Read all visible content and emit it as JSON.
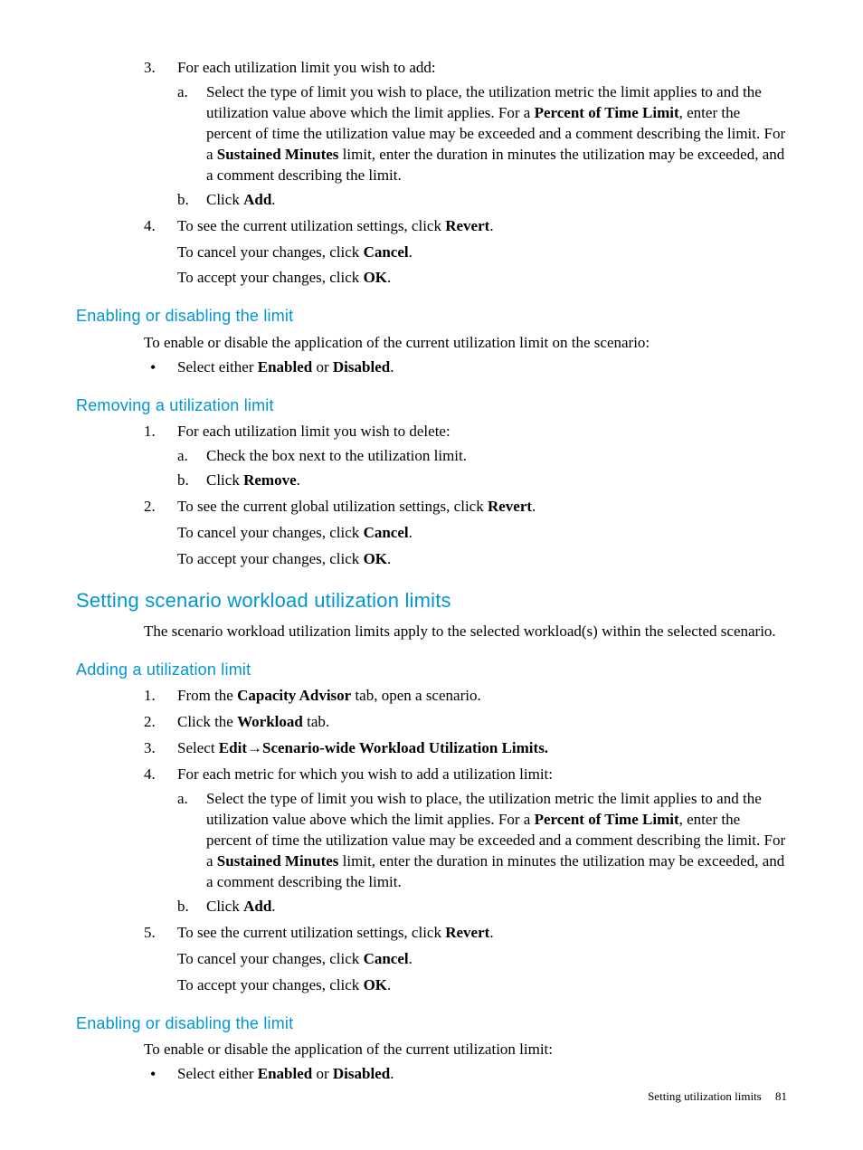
{
  "sec1": {
    "ol": [
      {
        "n": "3.",
        "t": "For each utilization limit you wish to add:",
        "sub": [
          {
            "n": "a.",
            "pre": "Select the type of limit you wish to place, the utilization metric the limit applies to and the utilization value above which the limit applies. For a ",
            "b1": "Percent of Time Limit",
            "mid": ", enter the percent of time the utilization value may be exceeded and a comment describing the limit. For a ",
            "b2": "Sustained Minutes",
            "post": " limit, enter the duration in minutes the utilization may be exceeded, and a comment describing the limit."
          },
          {
            "n": "b.",
            "pre": "Click ",
            "b1": "Add",
            "post": "."
          }
        ]
      },
      {
        "n": "4.",
        "l1_a": "To see the current utilization settings, click ",
        "l1_b": "Revert",
        "l1_c": ".",
        "l2_a": "To cancel your changes, click ",
        "l2_b": "Cancel",
        "l2_c": ".",
        "l3_a": "To accept your changes, click ",
        "l3_b": "OK",
        "l3_c": "."
      }
    ]
  },
  "sec2": {
    "title": "Enabling or disabling the limit",
    "intro": "To enable or disable the application of the current utilization limit on the scenario:",
    "bullet_a": "Select either ",
    "bullet_b1": "Enabled",
    "bullet_mid": " or ",
    "bullet_b2": "Disabled",
    "bullet_c": "."
  },
  "sec3": {
    "title": "Removing a utilization limit",
    "ol": [
      {
        "n": "1.",
        "t": "For each utilization limit you wish to delete:",
        "sub": [
          {
            "n": "a.",
            "t": "Check the box next to the utilization limit."
          },
          {
            "n": "b.",
            "pre": "Click ",
            "b1": "Remove",
            "post": "."
          }
        ]
      },
      {
        "n": "2.",
        "l1_a": "To see the current global utilization settings, click ",
        "l1_b": "Revert",
        "l1_c": ".",
        "l2_a": "To cancel your changes, click ",
        "l2_b": "Cancel",
        "l2_c": ".",
        "l3_a": "To accept your changes, click ",
        "l3_b": "OK",
        "l3_c": "."
      }
    ]
  },
  "sec4": {
    "title": "Setting scenario workload utilization limits",
    "intro": "The scenario workload utilization limits apply to the selected workload(s) within the selected scenario."
  },
  "sec5": {
    "title": "Adding a utilization limit",
    "ol": [
      {
        "n": "1.",
        "pre": "From the ",
        "b1": "Capacity Advisor",
        "post": " tab, open a scenario."
      },
      {
        "n": "2.",
        "pre": "Click the ",
        "b1": "Workload",
        "post": " tab."
      },
      {
        "n": "3.",
        "pre": "Select ",
        "b1": "Edit",
        "arrow": "→",
        "b2": "Scenario-wide Workload Utilization Limits."
      },
      {
        "n": "4.",
        "t": "For each metric for which you wish to add a utilization limit:",
        "sub": [
          {
            "n": "a.",
            "pre": "Select the type of limit you wish to place, the utilization metric the limit applies to and the utilization value above which the limit applies. For a ",
            "b1": "Percent of Time Limit",
            "mid": ", enter the percent of time the utilization value may be exceeded and a comment describing the limit. For a ",
            "b2": "Sustained Minutes",
            "post": " limit, enter the duration in minutes the utilization may be exceeded, and a comment describing the limit."
          },
          {
            "n": "b.",
            "pre": "Click ",
            "b1": "Add",
            "post": "."
          }
        ]
      },
      {
        "n": "5.",
        "l1_a": "To see the current utilization settings, click ",
        "l1_b": "Revert",
        "l1_c": ".",
        "l2_a": "To cancel your changes, click ",
        "l2_b": "Cancel",
        "l2_c": ".",
        "l3_a": "To accept your changes, click ",
        "l3_b": "OK",
        "l3_c": "."
      }
    ]
  },
  "sec6": {
    "title": "Enabling or disabling the limit",
    "intro": "To enable or disable the application of the current utilization limit:",
    "bullet_a": "Select either ",
    "bullet_b1": "Enabled",
    "bullet_mid": " or ",
    "bullet_b2": "Disabled",
    "bullet_c": "."
  },
  "footer": {
    "label": "Setting utilization limits",
    "page": "81"
  }
}
